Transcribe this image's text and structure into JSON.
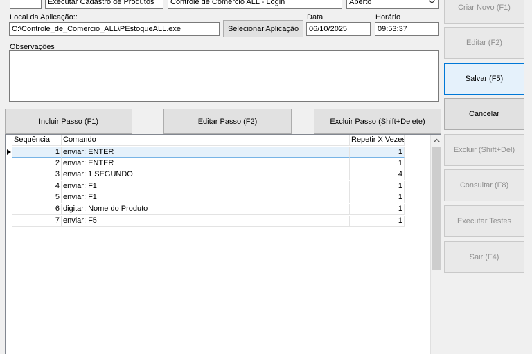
{
  "top": {
    "id_value": "",
    "name_value": "Executar Cadastro de Produtos",
    "window_value": "Controle de Comercio ALL - Login",
    "status_value": "Aberto"
  },
  "app": {
    "label": "Local da Aplicação::",
    "path": "C:\\Controle_de_Comercio_ALL\\PEstoqueALL.exe",
    "select_button": "Selecionar Aplicação"
  },
  "date": {
    "label": "Data",
    "value": "06/10/2025"
  },
  "time": {
    "label": "Horário",
    "value": "09:53:37"
  },
  "notes": {
    "label": "Observações",
    "value": ""
  },
  "step_buttons": {
    "include": "Incluir Passo (F1)",
    "edit": "Editar Passo (F2)",
    "delete": "Excluir Passo (Shift+Delete)"
  },
  "grid": {
    "columns": [
      "Sequência",
      "Comando",
      "Repetir X Vezes"
    ],
    "rows": [
      {
        "seq": "1",
        "cmd": "enviar: ENTER",
        "rep": "1"
      },
      {
        "seq": "2",
        "cmd": "enviar: ENTER",
        "rep": "1"
      },
      {
        "seq": "3",
        "cmd": "enviar: 1 SEGUNDO",
        "rep": "4"
      },
      {
        "seq": "4",
        "cmd": "enviar: F1",
        "rep": "1"
      },
      {
        "seq": "5",
        "cmd": "enviar: F1",
        "rep": "1"
      },
      {
        "seq": "6",
        "cmd": "digitar: Nome do Produto",
        "rep": "1"
      },
      {
        "seq": "7",
        "cmd": "enviar: F5",
        "rep": "1"
      }
    ]
  },
  "side_buttons": {
    "new": "Criar Novo (F1)",
    "edit": "Editar (F2)",
    "save": "Salvar (F5)",
    "cancel": "Cancelar",
    "delete": "Excluir (Shift+Del)",
    "query": "Consultar (F8)",
    "test": "Executar Testes",
    "exit": "Sair (F4)"
  },
  "icons": {
    "row_indicator": "current-row-arrow-icon",
    "dropdown": "chevron-down-icon",
    "scroll_up": "scroll-up-arrow-icon"
  }
}
